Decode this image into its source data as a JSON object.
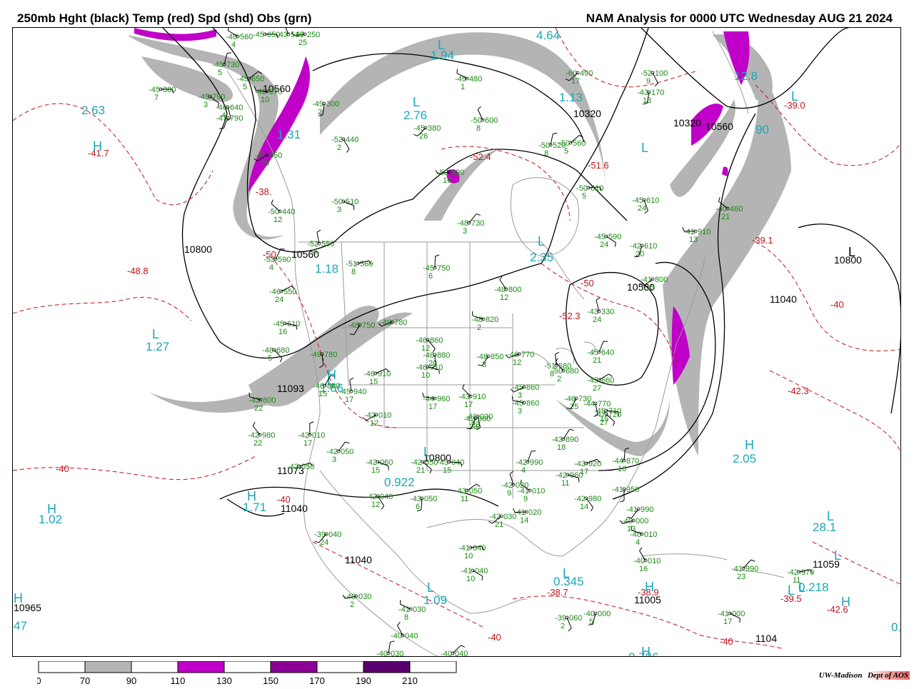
{
  "header": {
    "left_title": "250mb Hght (black) Temp (red) Spd (shd) Obs (grn)",
    "right_title": "NAM Analysis for 0000 UTC Wednesday  AUG 21 2024"
  },
  "colors": {
    "height_contour": "#000000",
    "temperature_contour": "#c0141a",
    "speed_70_90": "#b4b4b4",
    "speed_110_130": "#c000c8",
    "speed_150_170": "#8c0096",
    "speed_190_210": "#5a006e",
    "observations": "#1a8a12",
    "extrema_labels": "#1aa7b8",
    "geography": "#9a9a9a"
  },
  "legend": {
    "ticks": [
      "0",
      "70",
      "90",
      "110",
      "130",
      "150",
      "170",
      "190",
      "210"
    ],
    "bins": [
      {
        "color": "#ffffff"
      },
      {
        "color": "#b4b4b4"
      },
      {
        "color": "#ffffff"
      },
      {
        "color": "#c000c8"
      },
      {
        "color": "#ffffff"
      },
      {
        "color": "#8c0096"
      },
      {
        "color": "#ffffff"
      },
      {
        "color": "#5a006e"
      },
      {
        "color": "#ffffff"
      }
    ]
  },
  "credit": {
    "org": "UW-Madison",
    "dept": "Dept of AOS"
  },
  "height_labels": [
    "10800",
    "10560",
    "10560",
    "10320",
    "10320",
    "10560",
    "10560",
    "10800",
    "11040",
    "11093",
    "10800",
    "11073",
    "11040",
    "11040",
    "11005",
    "11059",
    "10965",
    "1104"
  ],
  "temp_labels": [
    "-41.7",
    "-38.",
    "-48.8",
    "-52.4",
    "-51.6",
    "-52.3",
    "-50",
    "-50",
    "-39.0",
    "-39.1",
    "-40",
    "-42.3",
    "-40",
    "-40",
    "-38.7",
    "-38.9",
    "-39.5",
    "-42.6",
    "-40",
    "-40"
  ],
  "extrema_letters": [
    "H",
    "L",
    "L",
    "L",
    "L",
    "H",
    "L",
    "L",
    "H",
    "H",
    "L",
    "L",
    "H",
    "H",
    "L",
    "L",
    "L",
    "H",
    "L",
    "L",
    "H",
    "H",
    "L",
    "L"
  ],
  "extrema_values": [
    "2.63",
    "2.76",
    "1.94",
    "2.35",
    "1.27",
    "1.18",
    "0.922",
    "1.71",
    "1.02",
    "1.09",
    "0.345",
    "0.786",
    "2.05",
    "28.1",
    "12.8",
    "90",
    "4.64",
    "1.13",
    "1.31",
    "1.66",
    "0.218",
    "47",
    "0."
  ],
  "observations": [
    {
      "t": "-45",
      "h": "880",
      "d": "7"
    },
    {
      "t": "-45",
      "h": "790",
      "d": "3"
    },
    {
      "t": "-46",
      "h": "640",
      "d": "4"
    },
    {
      "t": "-47",
      "h": "790",
      "d": ""
    },
    {
      "t": "-42",
      "h": "350",
      "d": "30"
    },
    {
      "t": "-48",
      "h": "670",
      "d": "10"
    },
    {
      "t": "-50",
      "h": "440",
      "d": "12"
    },
    {
      "t": "-52",
      "h": "550",
      "d": "8"
    },
    {
      "t": "-53",
      "h": "590",
      "d": "4"
    },
    {
      "t": "-46",
      "h": "550",
      "d": "24"
    },
    {
      "t": "-45",
      "h": "610",
      "d": "16"
    },
    {
      "t": "-48",
      "h": "680",
      "d": "5"
    },
    {
      "t": "-49",
      "h": "780",
      "d": ""
    },
    {
      "t": "-48",
      "h": "750",
      "d": ""
    },
    {
      "t": "-49",
      "h": "780",
      "d": ""
    },
    {
      "t": "-43",
      "h": "800",
      "d": "22"
    },
    {
      "t": "-42",
      "h": "980",
      "d": "22"
    },
    {
      "t": "-42",
      "h": "010",
      "d": "17"
    },
    {
      "t": "-42",
      "h": "050",
      "d": "3"
    },
    {
      "t": "-42",
      "h": "050",
      "d": ""
    },
    {
      "t": "-42",
      "h": "060",
      "d": "15"
    },
    {
      "t": "-42",
      "h": "040",
      "d": "12"
    },
    {
      "t": "-43",
      "h": "050",
      "d": "6"
    },
    {
      "t": "-39",
      "h": "040",
      "d": "24"
    },
    {
      "t": "-40",
      "h": "030",
      "d": "2"
    },
    {
      "t": "-41",
      "h": "030",
      "d": "8"
    },
    {
      "t": "-40",
      "h": "040",
      "d": ""
    },
    {
      "t": "-40",
      "h": "030",
      "d": ""
    },
    {
      "t": "-40",
      "h": "040",
      "d": ""
    },
    {
      "t": "-41",
      "h": "040",
      "d": "10"
    },
    {
      "t": "-41",
      "h": "040",
      "d": "10"
    },
    {
      "t": "-39",
      "h": "060",
      "d": "2"
    },
    {
      "t": "-40",
      "h": "000",
      "d": "5"
    },
    {
      "t": "-42",
      "h": "030",
      "d": "21"
    },
    {
      "t": "-41",
      "h": "020",
      "d": "14"
    },
    {
      "t": "-41",
      "h": "010",
      "d": "9"
    },
    {
      "t": "-42",
      "h": "020",
      "d": "9"
    },
    {
      "t": "-42",
      "h": "990",
      "d": "4"
    },
    {
      "t": "-43",
      "h": "050",
      "d": "11"
    },
    {
      "t": "-43",
      "h": "040",
      "d": "15"
    },
    {
      "t": "-42",
      "h": "050",
      "d": "21"
    },
    {
      "t": "-41",
      "h": "030",
      "d": "23"
    },
    {
      "t": "-42",
      "h": "980",
      "d": "23"
    },
    {
      "t": "-43",
      "h": "010",
      "d": "12"
    },
    {
      "t": "-44",
      "h": "960",
      "d": "17"
    },
    {
      "t": "-43",
      "h": "910",
      "d": "17"
    },
    {
      "t": "-45",
      "h": "940",
      "d": "17"
    },
    {
      "t": "-46",
      "h": "880",
      "d": "15"
    },
    {
      "t": "-46",
      "h": "910",
      "d": "15"
    },
    {
      "t": "-46",
      "h": "910",
      "d": "10"
    },
    {
      "t": "-46",
      "h": "860",
      "d": "12"
    },
    {
      "t": "-46",
      "h": "880",
      "d": "20"
    },
    {
      "t": "-48",
      "h": "850",
      "d": "3"
    },
    {
      "t": "-46",
      "h": "770",
      "d": "12"
    },
    {
      "t": "-48",
      "h": "820",
      "d": "2"
    },
    {
      "t": "-48",
      "h": "800",
      "d": "12"
    },
    {
      "t": "-45",
      "h": "750",
      "d": "6"
    },
    {
      "t": "-48",
      "h": "730",
      "d": "3"
    },
    {
      "t": "-51",
      "h": "560",
      "d": "8"
    },
    {
      "t": "-50",
      "h": "510",
      "d": "3"
    },
    {
      "t": "-52",
      "h": "440",
      "d": "2"
    },
    {
      "t": "-49",
      "h": "300",
      "d": "2"
    },
    {
      "t": "-45",
      "h": "380",
      "d": "26"
    },
    {
      "t": "-50",
      "h": "590",
      "d": "16"
    },
    {
      "t": "-49",
      "h": "480",
      "d": "1"
    },
    {
      "t": "-50",
      "h": "600",
      "d": "8"
    },
    {
      "t": "-50",
      "h": "520",
      "d": "8"
    },
    {
      "t": "-50",
      "h": "560",
      "d": "5"
    },
    {
      "t": "-50",
      "h": "610",
      "d": "5"
    },
    {
      "t": "-45",
      "h": "590",
      "d": "24"
    },
    {
      "t": "-45",
      "h": "610",
      "d": "24"
    },
    {
      "t": "-42",
      "h": "610",
      "d": "20"
    },
    {
      "t": "-41",
      "h": "800",
      "d": "15"
    },
    {
      "t": "-41",
      "h": "910",
      "d": "13"
    },
    {
      "t": "-40",
      "h": "460",
      "d": "21"
    },
    {
      "t": "-43",
      "h": "330",
      "d": "24"
    },
    {
      "t": "-45",
      "h": "640",
      "d": "21"
    },
    {
      "t": "-45",
      "h": "660",
      "d": "27"
    },
    {
      "t": "-45",
      "h": "710",
      "d": "15"
    },
    {
      "t": "-47",
      "h": "720",
      "d": "27"
    },
    {
      "t": "-44",
      "h": "770",
      "d": ""
    },
    {
      "t": "-46",
      "h": "730",
      "d": "25"
    },
    {
      "t": "-45",
      "h": "860",
      "d": "3"
    },
    {
      "t": "-45",
      "h": "860",
      "d": "3"
    },
    {
      "t": "-50",
      "h": "680",
      "d": "2"
    },
    {
      "t": "-51",
      "h": "680",
      "d": "8"
    },
    {
      "t": "-43",
      "h": "890",
      "d": "18"
    },
    {
      "t": "-43",
      "h": "920",
      "d": "17"
    },
    {
      "t": "-42",
      "h": "960",
      "d": "11"
    },
    {
      "t": "-42",
      "h": "980",
      "d": "14"
    },
    {
      "t": "-41",
      "h": "950",
      "d": ""
    },
    {
      "t": "-41",
      "h": "990",
      "d": ""
    },
    {
      "t": "-40",
      "h": "000",
      "d": "13"
    },
    {
      "t": "-40",
      "h": "010",
      "d": "4"
    },
    {
      "t": "-40",
      "h": "010",
      "d": "16"
    },
    {
      "t": "-44",
      "h": "870",
      "d": "16"
    },
    {
      "t": "-41",
      "h": "990",
      "d": "23"
    },
    {
      "t": "-42",
      "h": "970",
      "d": "11"
    },
    {
      "t": "-41",
      "h": "000",
      "d": "17"
    },
    {
      "t": "-52",
      "h": "100",
      "d": "9"
    },
    {
      "t": "-43",
      "h": "170",
      "d": "13"
    },
    {
      "t": "-60",
      "h": "490",
      "d": "17"
    },
    {
      "t": "-47",
      "h": "250",
      "d": "25"
    },
    {
      "t": "-48",
      "h": "560",
      "d": "4"
    },
    {
      "t": "-43",
      "h": "510",
      "d": ""
    },
    {
      "t": "-45",
      "h": "730",
      "d": "5"
    },
    {
      "t": "-45",
      "h": "650",
      "d": "5"
    },
    {
      "t": "-45",
      "h": "650",
      "d": ""
    }
  ]
}
